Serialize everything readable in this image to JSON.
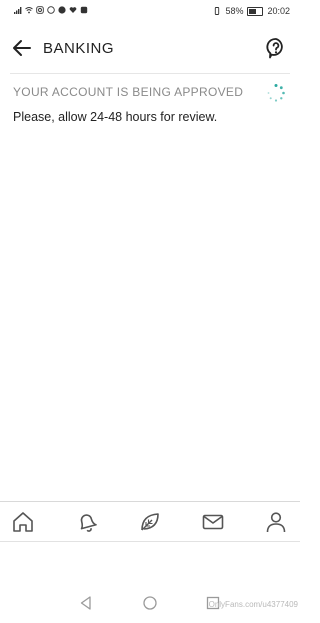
{
  "status_bar": {
    "battery_percent": "58%",
    "time": "20:02"
  },
  "header": {
    "title": "BANKING",
    "back_icon": "arrow-left-icon",
    "help_icon": "question-bubble-icon"
  },
  "approval": {
    "heading": "YOUR ACCOUNT IS BEING APPROVED",
    "message": "Please, allow 24-48 hours for review."
  },
  "bottom_nav": {
    "items": [
      {
        "icon": "home-icon"
      },
      {
        "icon": "bell-icon"
      },
      {
        "icon": "leaf-icon"
      },
      {
        "icon": "mail-icon"
      },
      {
        "icon": "user-icon"
      }
    ]
  },
  "colors": {
    "accent": "#2aa9a0",
    "muted_text": "#8a8a8a",
    "icon_stroke": "#555555"
  },
  "watermark": "OnlyFans.com/u4377409"
}
